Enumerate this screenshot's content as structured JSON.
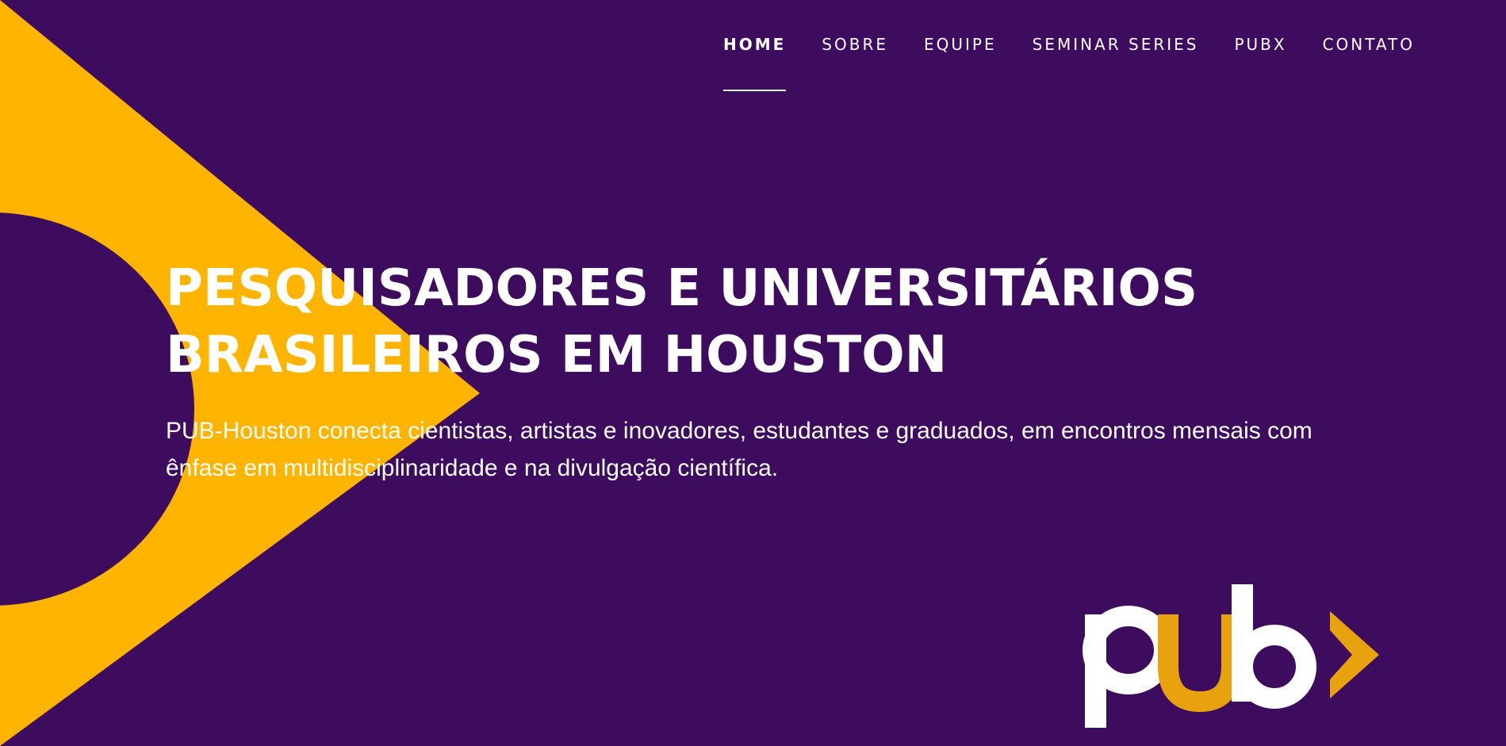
{
  "nav": {
    "items": [
      {
        "label": "HOME",
        "active": true
      },
      {
        "label": "SOBRE",
        "active": false
      },
      {
        "label": "EQUIPE",
        "active": false
      },
      {
        "label": "SEMINAR SERIES",
        "active": false
      },
      {
        "label": "PUBX",
        "active": false
      },
      {
        "label": "CONTATO",
        "active": false
      }
    ]
  },
  "hero": {
    "title_line1": "PESQUISADORES E UNIVERSITÁRIOS",
    "title_line2": "BRASILEIROS EM HOUSTON",
    "subtitle": "PUB-Houston conecta cientistas, artistas e inovadores, estudantes e graduados, em encontros mensais com ênfase em multidisciplinaridade e na divulgação científica."
  },
  "logo": {
    "text": "pub"
  },
  "colors": {
    "background": "#3d0c5f",
    "accent": "#ffb400",
    "logo_orange": "#e8a20d",
    "text": "#ffffff"
  }
}
